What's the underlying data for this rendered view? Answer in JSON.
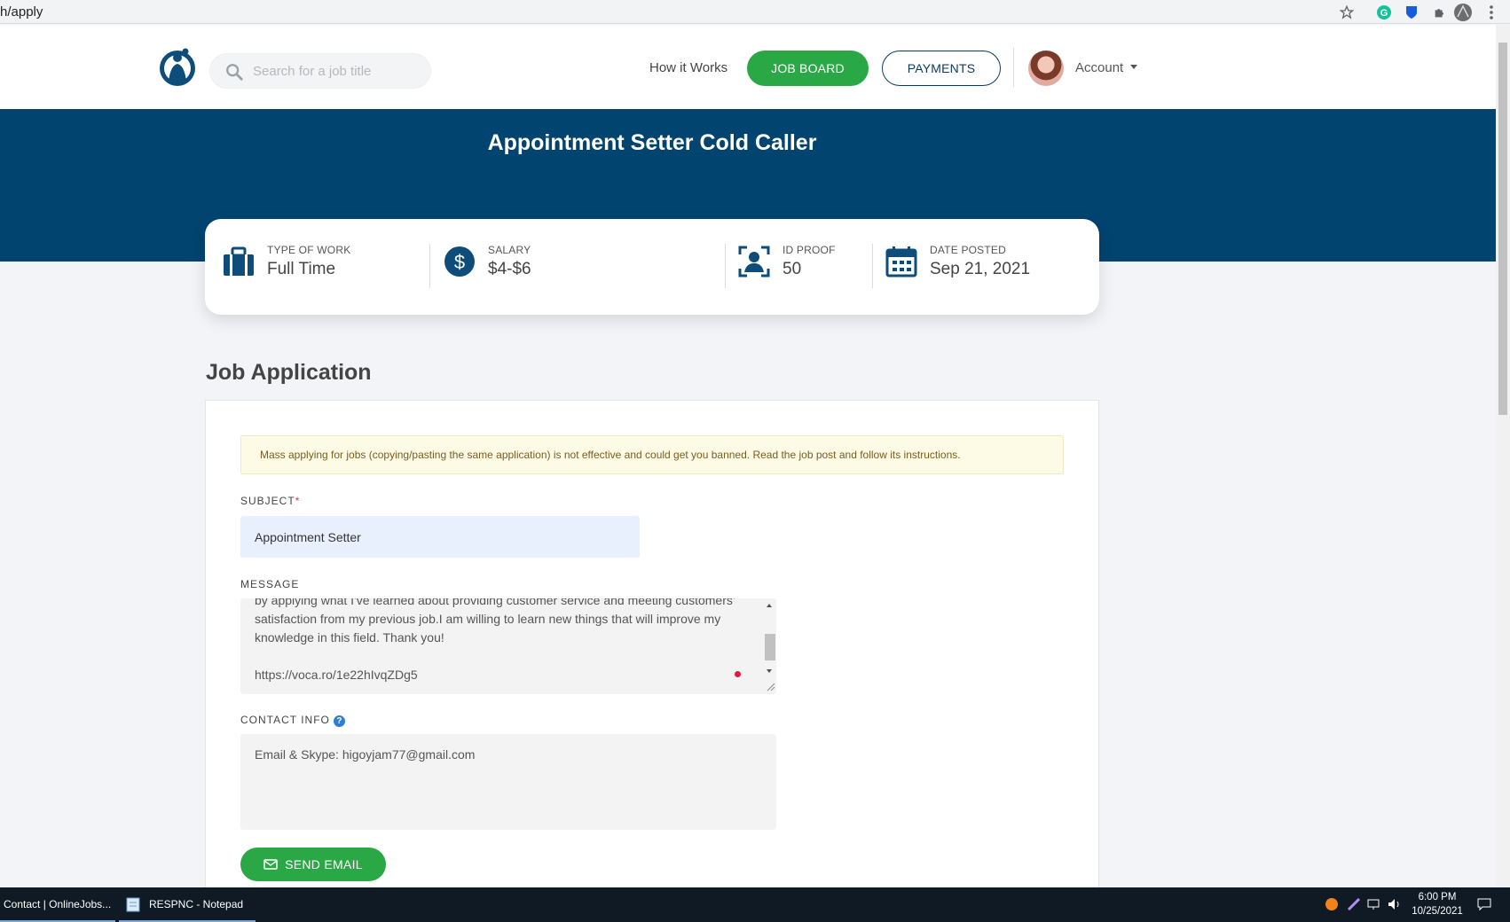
{
  "browser": {
    "url_fragment": "h/apply"
  },
  "nav": {
    "search_placeholder": "Search for a job title",
    "how_it_works": "How it Works",
    "job_board": "JOB BOARD",
    "payments": "PAYMENTS",
    "account": "Account"
  },
  "job": {
    "title": "Appointment Setter Cold Caller",
    "details": [
      {
        "label": "TYPE OF WORK",
        "value": "Full Time",
        "icon": "briefcase-icon"
      },
      {
        "label": "SALARY",
        "value": "$4-$6",
        "icon": "dollar-icon"
      },
      {
        "label": "ID PROOF",
        "value": "50",
        "icon": "id-proof-icon"
      },
      {
        "label": "DATE POSTED",
        "value": "Sep 21, 2021",
        "icon": "calendar-icon"
      }
    ]
  },
  "application": {
    "heading": "Job Application",
    "warning": "Mass applying for jobs (copying/pasting the same application) is not effective and could get you banned. Read the job post and follow its instructions.",
    "subject_label": "SUBJECT",
    "required_mark": "*",
    "subject_value": "Appointment Setter",
    "message_label": "MESSAGE",
    "message_text": "by applying what I've learned about providing customer service and meeting customers'\nsatisfaction from my previous job.I am willing to learn new things that will improve my\nknowledge in this field. Thank you!\n\nhttps://voca.ro/1e22hIvqZDg5",
    "contact_label": "CONTACT INFO",
    "contact_value": "Email & Skype: higoyjam77@gmail.com",
    "send_button": "SEND EMAIL"
  },
  "taskbar": {
    "tasks": [
      "Contact | OnlineJobs...",
      "RESPNC - Notepad"
    ],
    "time": "6:00 PM",
    "date": "10/25/2021"
  },
  "colors": {
    "hero": "#01446f",
    "green": "#2aa846",
    "navy": "#0c3a5f"
  }
}
